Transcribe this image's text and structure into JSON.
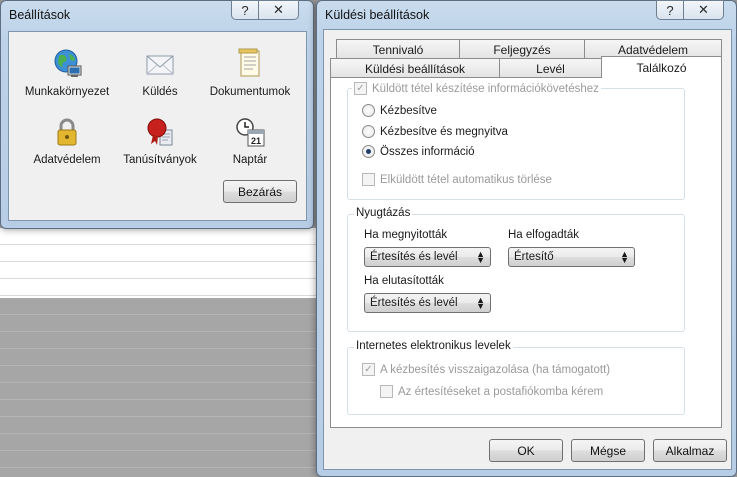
{
  "small_dialog": {
    "title": "Beállítások",
    "help_glyph": "?",
    "close_glyph": "✕",
    "items": [
      {
        "label": "Munkakörnyezet",
        "icon": "globe-computer-icon"
      },
      {
        "label": "Küldés",
        "icon": "envelope-icon"
      },
      {
        "label": "Dokumentumok",
        "icon": "document-icon"
      },
      {
        "label": "Adatvédelem",
        "icon": "padlock-icon"
      },
      {
        "label": "Tanúsítványok",
        "icon": "certificate-seal-icon"
      },
      {
        "label": "Naptár",
        "icon": "calendar-clock-icon"
      }
    ],
    "close_button": "Bezárás",
    "calendar_day": "21"
  },
  "send_dialog": {
    "title": "Küldési beállítások",
    "help_glyph": "?",
    "close_glyph": "✕",
    "tabs_back": [
      "Tennivaló",
      "Feljegyzés",
      "Adatvédelem"
    ],
    "tabs_front": [
      "Küldési beállítások",
      "Levél",
      "Találkozó"
    ],
    "active_tab": "Találkozó",
    "tracking": {
      "label": "Küldött tétel készítése információkövetéshez",
      "options": [
        "Kézbesítve",
        "Kézbesítve és megnyitva",
        "Összes információ"
      ],
      "selected": "Összes információ",
      "auto_delete": "Elküldött tétel automatikus törlése"
    },
    "ack": {
      "title": "Nyugtázás",
      "opened_label": "Ha megnyitották",
      "opened_value": "Értesítés és levél",
      "accepted_label": "Ha elfogadták",
      "accepted_value": "Értesítő",
      "declined_label": "Ha elutasították",
      "declined_value": "Értesítés és levél"
    },
    "internet": {
      "title": "Internetes elektronikus levelek",
      "receipt": "A kézbesítés visszaigazolása (ha támogatott)",
      "mailbox": "Az értesítéseket a postafiókomba kérem"
    },
    "buttons": {
      "ok": "OK",
      "cancel": "Mégse",
      "apply": "Alkalmaz"
    }
  }
}
